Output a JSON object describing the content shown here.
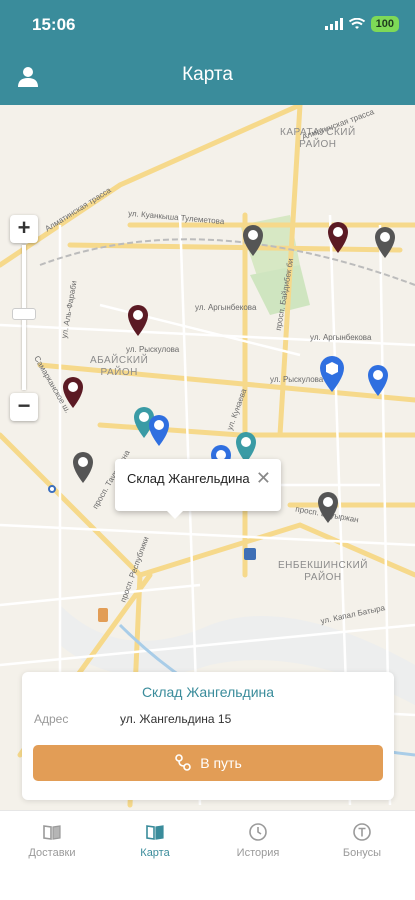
{
  "status_bar": {
    "time": "15:06",
    "battery": "100"
  },
  "header": {
    "title": "Карта"
  },
  "map": {
    "districts": [
      {
        "key": "karatau",
        "text": "КАРАТАУСКИЙ\nРАЙОН"
      },
      {
        "key": "abay",
        "text": "АБАЙСКИЙ\nРАЙОН"
      },
      {
        "key": "enbekshi",
        "text": "ЕНБЕКШИНСКИЙ\nРАЙОН"
      }
    ],
    "streets": [
      "Алматинская трасса",
      "ул. Куанкыша Тулеметова",
      "ул. Рыскулова",
      "ул. Аргынбекова",
      "ул. Рыскулова",
      "просп. Байдибек би",
      "ул. Аргынбекова",
      "ул. Кунаева",
      "просп. Республики",
      "ул. Капал Батыра",
      "Алматинская трасса",
      "ул. Аль-Фараби",
      "Самарканское ш.",
      "просп. Тауке хана",
      "просп. Бауыржан"
    ],
    "zoom_in": "+",
    "zoom_out": "−",
    "callout": {
      "text": "Склад Жангельдина",
      "close": "✕"
    }
  },
  "card": {
    "title": "Склад Жангельдина",
    "address_label": "Адрес",
    "address_value": "ул. Жангельдина 15",
    "route_button": "В путь"
  },
  "tabs": [
    {
      "label": "Доставки",
      "icon": "book-icon",
      "active": false
    },
    {
      "label": "Карта",
      "icon": "map-book-icon",
      "active": true
    },
    {
      "label": "История",
      "icon": "clock-icon",
      "active": false
    },
    {
      "label": "Бонусы",
      "icon": "coin-icon",
      "active": false
    }
  ],
  "colors": {
    "primary": "#3a8c9b",
    "accent": "#e29d56",
    "pin_dark_red": "#5b1a24",
    "pin_gray": "#555555",
    "pin_blue": "#2f6fe0",
    "pin_teal": "#3a9ba5"
  }
}
